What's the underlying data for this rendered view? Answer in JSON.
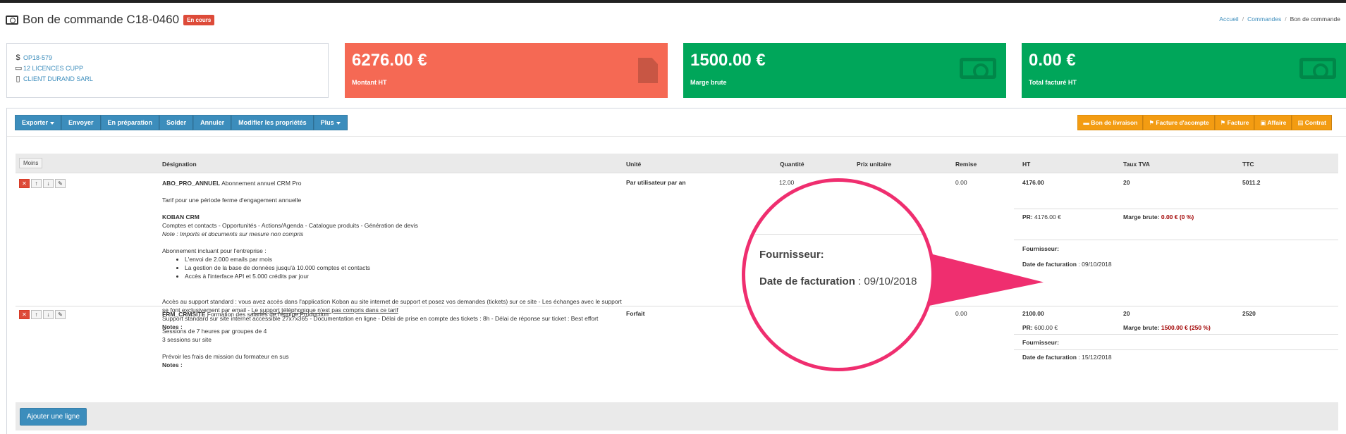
{
  "header": {
    "title": "Bon de commande C18-0460",
    "status": "En cours",
    "breadcrumb": [
      "Accueil",
      "Commandes",
      "Bon de commande"
    ]
  },
  "info": {
    "opportunity": "OP18-579",
    "product": "12 LICENCES CUPP",
    "client": "CLIENT DURAND SARL"
  },
  "stats": [
    {
      "value": "6276.00 €",
      "label": "Montant HT",
      "color": "#f56954",
      "icon": "document-icon"
    },
    {
      "value": "1500.00 €",
      "label": "Marge brute",
      "color": "#00a65a",
      "icon": "money-icon"
    },
    {
      "value": "0.00 €",
      "label": "Total facturé HT",
      "color": "#00a65a",
      "icon": "money-icon"
    }
  ],
  "toolbar": {
    "left": [
      "Exporter",
      "Envoyer",
      "En préparation",
      "Solder",
      "Annuler",
      "Modifier les propriétés",
      "Plus"
    ],
    "right": [
      "Bon de livraison",
      "Facture d'acompte",
      "Facture",
      "Affaire",
      "Contrat"
    ]
  },
  "table": {
    "toggle": "Moins",
    "headers": [
      "Désignation",
      "Unité",
      "Quantité",
      "Prix unitaire",
      "Remise",
      "HT",
      "Taux TVA",
      "TTC"
    ]
  },
  "rows": [
    {
      "code": "ABO_PRO_ANNUEL",
      "name": "Abonnement annuel CRM Pro",
      "unit": "Par utilisateur par an",
      "qty": "12.00",
      "remise": "0.00",
      "ht": "4176.00",
      "tva": "20",
      "ttc": "5011.2",
      "desc_1": "Tarif pour une période ferme d'engagement annuelle",
      "desc_brand": "KOBAN CRM",
      "desc_features": "Comptes et contacts - Opportunités - Actions/Agenda - Catalogue produits - Génération de devis",
      "desc_note": "Note : Imports et documents sur mesure non compris",
      "desc_incl": "Abonnement incluant pour l'entreprise :",
      "desc_items": [
        "L'envoi de 2.000 emails par mois",
        "La gestion de la base de données jusqu'à 10.000 comptes et contacts",
        "Accès à l'interface API et 5.000 crédits par jour"
      ],
      "desc_support_1": "Accès au support standard : vous avez accès dans l'application Koban au site internet de support et posez vos demandes (tickets) sur ce site - Les échanges avec le support",
      "desc_support_2a": "se font exclusivement par email -",
      "desc_support_2b": "Le support téléphonique n'est pas compris dans ce tarif",
      "desc_support_3": "Support standard sur site internet accessible 27x7x365 - Documentation en ligne - Délai de prise en compte des tickets : 8h - Délai de réponse sur ticket : Best effort",
      "notes_label": "Notes :",
      "pr_label": "PR:",
      "pr_value": "4176.00 €",
      "marge_label": "Marge brute:",
      "marge_value": "0.00 € (0 %)",
      "fourn_label": "Fournisseur:",
      "date_label": "Date de facturation",
      "date_value": ": 09/10/2018"
    },
    {
      "code": "FRM_CRMSITE",
      "name": "Formation des salariés de l'équipe Production",
      "unit": "Forfait",
      "remise": "0.00",
      "ht": "2100.00",
      "tva": "20",
      "ttc": "2520",
      "desc_1": "Sessions de 7 heures par groupes de 4",
      "desc_2": "3 sessions sur site",
      "desc_3": "Prévoir les frais de mission du formateur en sus",
      "notes_label": "Notes :",
      "pr_label": "PR:",
      "pr_value": "600.00 €",
      "marge_label": "Marge brute:",
      "marge_value": "1500.00 € (250 %)",
      "fourn_label": "Fournisseur:",
      "date_label": "Date de facturation",
      "date_value": ": 15/12/2018"
    }
  ],
  "add_line": "Ajouter une ligne",
  "magnifier": {
    "fourn_label": "Fournisseur:",
    "date_label": "Date de facturation",
    "date_value": ": 09/10/2018"
  },
  "colors": {
    "accent": "#3c8dbc",
    "orange": "#f39c12",
    "highlight": "#ef2e6f"
  }
}
